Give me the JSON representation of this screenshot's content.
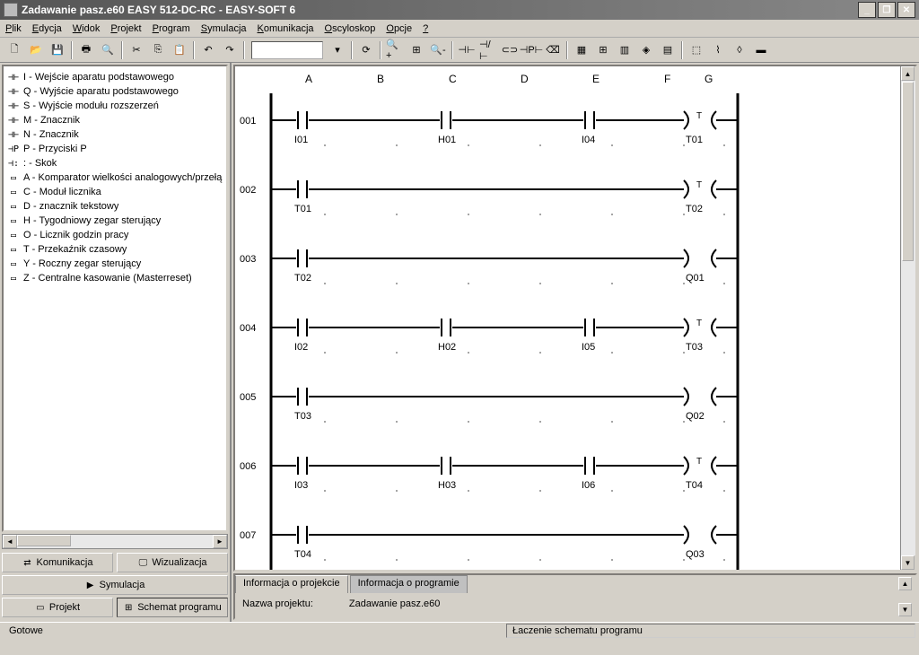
{
  "title": "Zadawanie pasz.e60 EASY 512-DC-RC - EASY-SOFT 6",
  "menu": [
    "Plik",
    "Edycja",
    "Widok",
    "Projekt",
    "Program",
    "Symulacja",
    "Komunikacja",
    "Oscyloskop",
    "Opcje",
    "?"
  ],
  "tree": [
    {
      "icon": "⊣⊢",
      "label": "I - Wejście aparatu podstawowego"
    },
    {
      "icon": "⊣⊢",
      "label": "Q - Wyjście aparatu podstawowego"
    },
    {
      "icon": "⊣⊢",
      "label": "S - Wyjście modułu rozszerzeń"
    },
    {
      "icon": "⊣⊢",
      "label": "M - Znacznik"
    },
    {
      "icon": "⊣⊢",
      "label": "N - Znacznik"
    },
    {
      "icon": "⊣P",
      "label": "P - Przyciski P"
    },
    {
      "icon": "⊣:",
      "label": ": - Skok"
    },
    {
      "icon": "▭",
      "label": "A - Komparator wielkości analogowych/przełą"
    },
    {
      "icon": "▭",
      "label": "C - Moduł licznika"
    },
    {
      "icon": "▭",
      "label": "D - znacznik tekstowy"
    },
    {
      "icon": "▭",
      "label": "H - Tygodniowy zegar sterujący"
    },
    {
      "icon": "▭",
      "label": "O - Licznik godzin pracy"
    },
    {
      "icon": "▭",
      "label": "T - Przekaźnik czasowy"
    },
    {
      "icon": "▭",
      "label": "Y - Roczny zegar sterujący"
    },
    {
      "icon": "▭",
      "label": "Z - Centralne kasowanie (Masterreset)"
    }
  ],
  "bottom_buttons": {
    "komunikacja": "Komunikacja",
    "wizualizacja": "Wizualizacja",
    "symulacja": "Symulacja",
    "projekt": "Projekt",
    "schemat": "Schemat programu"
  },
  "columns": [
    "A",
    "B",
    "C",
    "D",
    "E",
    "F",
    "G"
  ],
  "rungs": [
    {
      "num": "001",
      "contacts": [
        {
          "col": 0,
          "label": "I01"
        },
        {
          "col": 2,
          "label": "H01"
        },
        {
          "col": 4,
          "label": "I04"
        }
      ],
      "coil": {
        "label": "T01",
        "top": "T"
      }
    },
    {
      "num": "002",
      "contacts": [
        {
          "col": 0,
          "label": "T01"
        }
      ],
      "coil": {
        "label": "T02",
        "top": "T"
      }
    },
    {
      "num": "003",
      "contacts": [
        {
          "col": 0,
          "label": "T02"
        }
      ],
      "coil": {
        "label": "Q01",
        "top": ""
      }
    },
    {
      "num": "004",
      "contacts": [
        {
          "col": 0,
          "label": "I02"
        },
        {
          "col": 2,
          "label": "H02"
        },
        {
          "col": 4,
          "label": "I05"
        }
      ],
      "coil": {
        "label": "T03",
        "top": "T"
      }
    },
    {
      "num": "005",
      "contacts": [
        {
          "col": 0,
          "label": "T03"
        }
      ],
      "coil": {
        "label": "Q02",
        "top": ""
      }
    },
    {
      "num": "006",
      "contacts": [
        {
          "col": 0,
          "label": "I03"
        },
        {
          "col": 2,
          "label": "H03"
        },
        {
          "col": 4,
          "label": "I06"
        }
      ],
      "coil": {
        "label": "T04",
        "top": "T"
      }
    },
    {
      "num": "007",
      "contacts": [
        {
          "col": 0,
          "label": "T04"
        }
      ],
      "coil": {
        "label": "Q03",
        "top": ""
      }
    }
  ],
  "info_tabs": {
    "active": "Informacja o projekcie",
    "inactive": "Informacja o programie"
  },
  "info_body": {
    "label": "Nazwa projektu:",
    "value": "Zadawanie pasz.e60"
  },
  "status": {
    "left": "Gotowe",
    "right": "Łaczenie schematu programu"
  }
}
